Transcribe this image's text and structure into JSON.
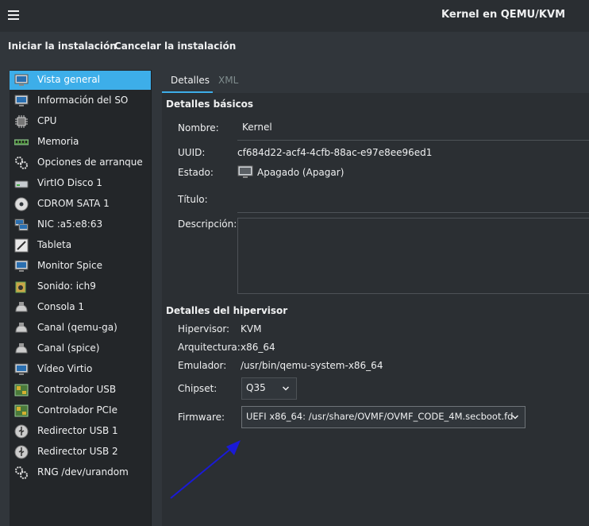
{
  "window": {
    "title": "Kernel en QEMU/KVM"
  },
  "actions": {
    "begin_install": "Iniciar la instalación",
    "cancel_install": "Cancelar la instalación"
  },
  "sidebar": {
    "items": [
      {
        "label": "Vista general",
        "icon": "monitor-icon"
      },
      {
        "label": "Información del SO",
        "icon": "monitor-icon"
      },
      {
        "label": "CPU",
        "icon": "chip-icon"
      },
      {
        "label": "Memoria",
        "icon": "memory-icon"
      },
      {
        "label": "Opciones de arranque",
        "icon": "gears-icon"
      },
      {
        "label": "VirtIO Disco 1",
        "icon": "disk-icon"
      },
      {
        "label": "CDROM SATA 1",
        "icon": "cdrom-icon"
      },
      {
        "label": "NIC :a5:e8:63",
        "icon": "network-icon"
      },
      {
        "label": "Tableta",
        "icon": "tablet-icon"
      },
      {
        "label": "Monitor Spice",
        "icon": "monitor-icon"
      },
      {
        "label": "Sonido: ich9",
        "icon": "sound-icon"
      },
      {
        "label": "Consola 1",
        "icon": "serial-icon"
      },
      {
        "label": "Canal (qemu-ga)",
        "icon": "serial-icon"
      },
      {
        "label": "Canal (spice)",
        "icon": "serial-icon"
      },
      {
        "label": "Vídeo Virtio",
        "icon": "monitor-icon"
      },
      {
        "label": "Controlador USB",
        "icon": "controller-icon"
      },
      {
        "label": "Controlador PCIe",
        "icon": "controller-icon"
      },
      {
        "label": "Redirector USB 1",
        "icon": "usb-icon"
      },
      {
        "label": "Redirector USB 2",
        "icon": "usb-icon"
      },
      {
        "label": "RNG /dev/urandom",
        "icon": "gears-icon"
      }
    ]
  },
  "tabs": {
    "details": "Detalles",
    "xml": "XML"
  },
  "basic": {
    "heading": "Detalles básicos",
    "name_label": "Nombre:",
    "name_value": "Kernel",
    "uuid_label": "UUID:",
    "uuid_value": "cf684d22-acf4-4cfb-88ac-e97e8ee96ed1",
    "state_label": "Estado:",
    "state_value": "Apagado (Apagar)",
    "title_label": "Título:",
    "title_value": "",
    "desc_label": "Descripción:",
    "desc_value": ""
  },
  "hypervisor": {
    "heading": "Detalles del hipervisor",
    "hv_label": "Hipervisor:",
    "hv_value": "KVM",
    "arch_label": "Arquitectura:",
    "arch_value": "x86_64",
    "emu_label": "Emulador:",
    "emu_value": "/usr/bin/qemu-system-x86_64",
    "chipset_label": "Chipset:",
    "chipset_value": "Q35",
    "fw_label": "Firmware:",
    "fw_value": "UEFI x86_64: /usr/share/OVMF/OVMF_CODE_4M.secboot.fd"
  },
  "colors": {
    "accent": "#3daee9",
    "annotation_arrow": "#1a1ad6"
  }
}
